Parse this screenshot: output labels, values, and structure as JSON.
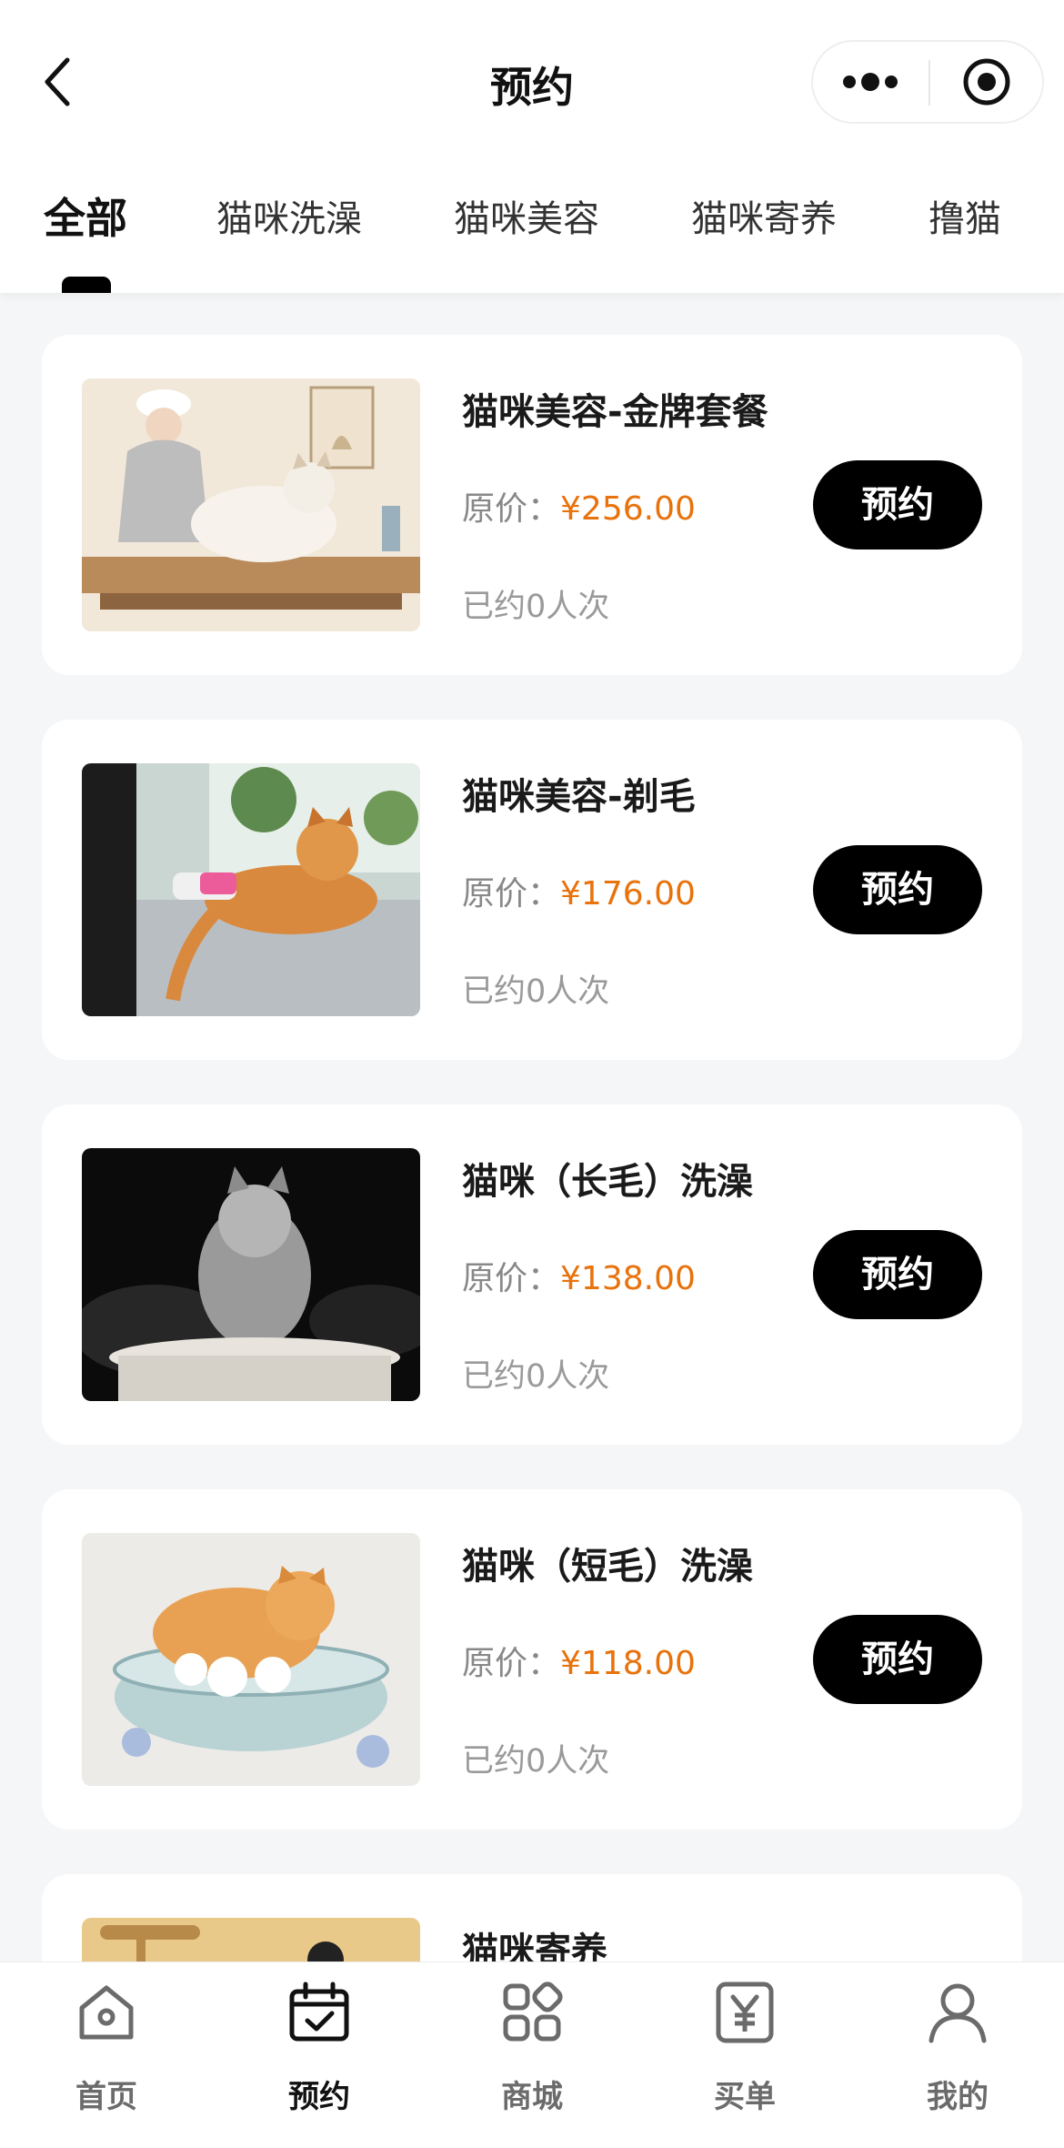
{
  "header": {
    "title": "预约",
    "back_icon": "chevron-left-icon",
    "more_icon": "more-dots-icon",
    "target_icon": "target-circle-icon"
  },
  "tabs": [
    {
      "label": "全部",
      "active": true
    },
    {
      "label": "猫咪洗澡",
      "active": false
    },
    {
      "label": "猫咪美容",
      "active": false
    },
    {
      "label": "猫咪寄养",
      "active": false
    },
    {
      "label": "撸猫",
      "active": false
    }
  ],
  "services": [
    {
      "title": "猫咪美容-金牌套餐",
      "price_label": "原价：",
      "price": "¥256.00",
      "booked": "已约0人次",
      "button": "预约"
    },
    {
      "title": "猫咪美容-剃毛",
      "price_label": "原价：",
      "price": "¥176.00",
      "booked": "已约0人次",
      "button": "预约"
    },
    {
      "title": "猫咪（长毛）洗澡",
      "price_label": "原价：",
      "price": "¥138.00",
      "booked": "已约0人次",
      "button": "预约"
    },
    {
      "title": "猫咪（短毛）洗澡",
      "price_label": "原价：",
      "price": "¥118.00",
      "booked": "已约0人次",
      "button": "预约"
    },
    {
      "title": "猫咪寄养",
      "price_label": "",
      "price": "",
      "booked": "",
      "button": ""
    }
  ],
  "bottom_nav": [
    {
      "label": "首页",
      "icon": "home-icon",
      "active": false
    },
    {
      "label": "预约",
      "icon": "calendar-check-icon",
      "active": true
    },
    {
      "label": "商城",
      "icon": "apps-grid-icon",
      "active": false
    },
    {
      "label": "买单",
      "icon": "yen-bill-icon",
      "active": false
    },
    {
      "label": "我的",
      "icon": "user-icon",
      "active": false
    }
  ],
  "colors": {
    "accent": "#000000",
    "price": "#e8720c",
    "background": "#f4f6f8"
  }
}
